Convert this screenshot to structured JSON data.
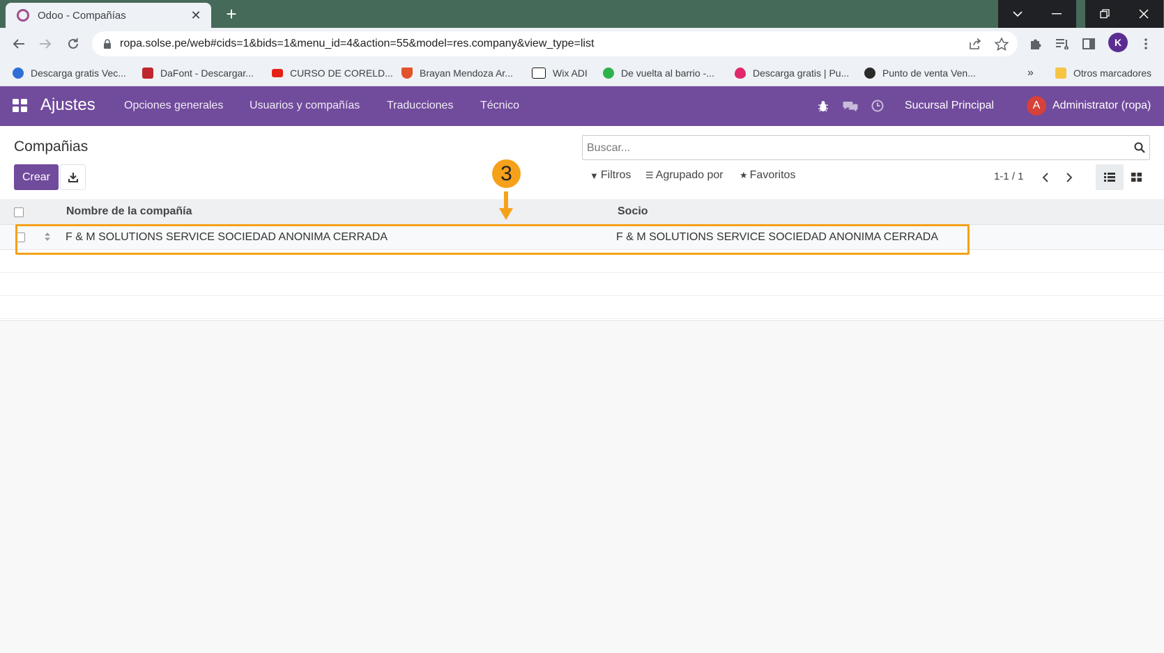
{
  "browser": {
    "tab_title": "Odoo - Compañías",
    "new_tab": "+",
    "url": "ropa.solse.pe/web#cids=1&bids=1&menu_id=4&action=55&model=res.company&view_type=list",
    "profile_initial": "K",
    "bookmarks": [
      {
        "label": "Descarga gratis Vec...",
        "color": "#2f6fd8"
      },
      {
        "label": "DaFont - Descargar...",
        "color": "#c0262d"
      },
      {
        "label": "CURSO DE CORELD...",
        "color": "#e62117"
      },
      {
        "label": "Brayan Mendoza Ar...",
        "color": "#e2522b"
      },
      {
        "label": "Wix ADI",
        "color": "#111111"
      },
      {
        "label": "De vuelta al barrio -...",
        "color": "#2fb24c"
      },
      {
        "label": "Descarga gratis | Pu...",
        "color": "#e0286a"
      },
      {
        "label": "Punto de venta Ven...",
        "color": "#2a2a2a"
      }
    ],
    "bookmarks_more": "»",
    "other_bookmarks": "Otros marcadores"
  },
  "navbar": {
    "app_name": "Ajustes",
    "menu": [
      "Opciones generales",
      "Usuarios y compañías",
      "Traducciones",
      "Técnico"
    ],
    "company": "Sucursal Principal",
    "avatar_initial": "A",
    "user": "Administrator (ropa)"
  },
  "control_panel": {
    "title": "Compañias",
    "create_label": "Crear",
    "search_placeholder": "Buscar...",
    "filters_label": "Filtros",
    "group_by_label": "Agrupado por",
    "favorites_label": "Favoritos",
    "pager": "1-1 / 1"
  },
  "list": {
    "columns": [
      "Nombre de la compañía",
      "Socio"
    ],
    "rows": [
      {
        "name": "F & M SOLUTIONS SERVICE SOCIEDAD ANONIMA CERRADA",
        "partner": "F & M SOLUTIONS SERVICE SOCIEDAD ANONIMA CERRADA"
      }
    ]
  },
  "annotation": {
    "step": "3",
    "color": "#f5a11a"
  },
  "colors": {
    "brand": "#714b9c",
    "tabbar": "#466a5a",
    "highlight": "#f5a11a"
  }
}
